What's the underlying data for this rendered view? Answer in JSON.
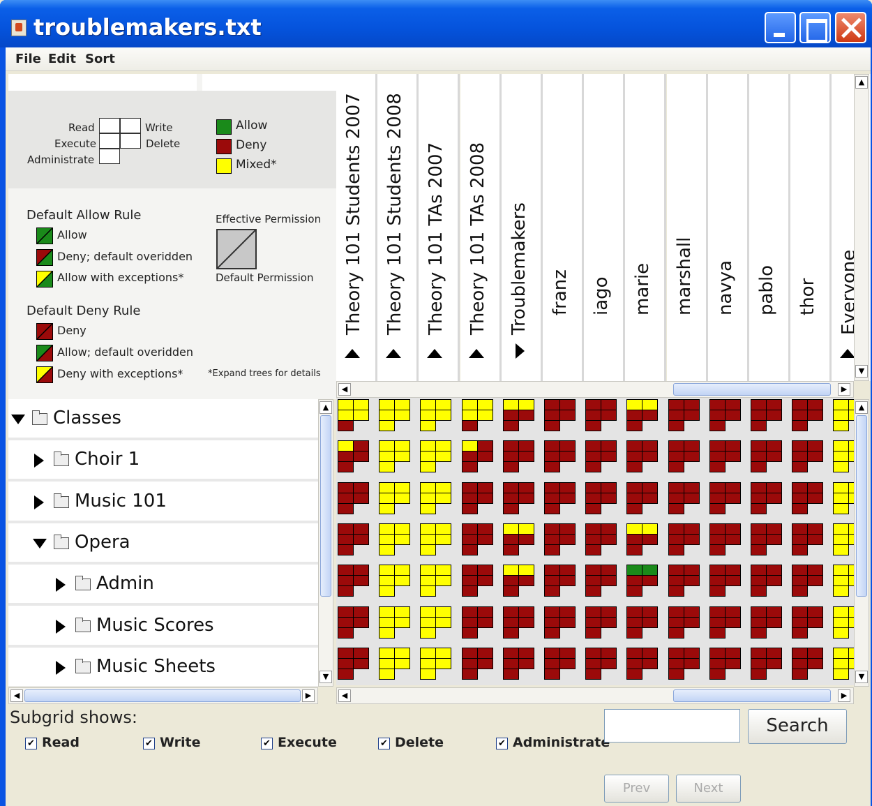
{
  "window": {
    "title": "troublemakers.txt"
  },
  "menu": [
    "File",
    "Edit",
    "Sort"
  ],
  "legend": {
    "layout_labels": {
      "read": "Read",
      "write": "Write",
      "execute": "Execute",
      "delete": "Delete",
      "administrate": "Administrate"
    },
    "colors": {
      "allow": "Allow",
      "deny": "Deny",
      "mixed": "Mixed*"
    },
    "palette": {
      "allow": "#1a8a1a",
      "deny": "#9b0a0a",
      "mixed": "#ffff00"
    },
    "default_allow_rule": {
      "title": "Default Allow Rule",
      "items": [
        "Allow",
        "Deny; default overidden",
        "Allow with exceptions*"
      ]
    },
    "default_deny_rule": {
      "title": "Default Deny Rule",
      "items": [
        "Deny",
        "Allow; default overidden",
        "Deny with exceptions*"
      ]
    },
    "effective_permission": "Effective Permission",
    "default_permission": "Default Permission",
    "footnote": "*Expand trees for details"
  },
  "columns": [
    {
      "label": "Theory 101 Students 2007",
      "arrow": "up"
    },
    {
      "label": "Theory 101 Students 2008",
      "arrow": "up"
    },
    {
      "label": "Theory 101 TAs 2007",
      "arrow": "up"
    },
    {
      "label": "Theory 101 TAs 2008",
      "arrow": "up"
    },
    {
      "label": "Troublemakers",
      "arrow": "right"
    },
    {
      "label": "franz",
      "arrow": ""
    },
    {
      "label": "iago",
      "arrow": ""
    },
    {
      "label": "marie",
      "arrow": ""
    },
    {
      "label": "marshall",
      "arrow": ""
    },
    {
      "label": "navya",
      "arrow": ""
    },
    {
      "label": "pablo",
      "arrow": ""
    },
    {
      "label": "thor",
      "arrow": ""
    },
    {
      "label": "Everyone",
      "arrow": "up"
    }
  ],
  "tree": [
    {
      "label": "Classes",
      "depth": 0,
      "expanded": true
    },
    {
      "label": "Choir 1",
      "depth": 1,
      "expanded": false
    },
    {
      "label": "Music 101",
      "depth": 1,
      "expanded": false
    },
    {
      "label": "Opera",
      "depth": 1,
      "expanded": true
    },
    {
      "label": "Admin",
      "depth": 2,
      "expanded": false
    },
    {
      "label": "Music Scores",
      "depth": 2,
      "expanded": false
    },
    {
      "label": "Music Sheets",
      "depth": 2,
      "expanded": false
    }
  ],
  "grid": [
    [
      "YYYYR",
      "YYYYY",
      "YYYYY",
      "YYYYR",
      "YYRRR",
      "RRRRR",
      "RRRRR",
      "YYRRR",
      "RRRRR",
      "RRRRR",
      "RRRRR",
      "RRRRR",
      "YYYYY"
    ],
    [
      "YRRRR",
      "YYYYY",
      "YYYYY",
      "YRRRR",
      "RRRRR",
      "RRRRR",
      "RRRRR",
      "RRRRR",
      "RRRRR",
      "RRRRR",
      "RRRRR",
      "RRRRR",
      "YYYYY"
    ],
    [
      "RRRRR",
      "YYYYY",
      "YYYYY",
      "RRRRR",
      "RRRRR",
      "RRRRR",
      "RRRRR",
      "RRRRR",
      "RRRRR",
      "RRRRR",
      "RRRRR",
      "RRRRR",
      "YYYYY"
    ],
    [
      "RRRRR",
      "YYYYY",
      "YYYYY",
      "RRRRR",
      "YYRRR",
      "RRRRR",
      "RRRRR",
      "YYRRR",
      "RRRRR",
      "RRRRR",
      "RRRRR",
      "RRRRR",
      "YYYYY"
    ],
    [
      "RRRRR",
      "YYYYY",
      "YYYYY",
      "RRRRR",
      "YYRRR",
      "RRRRR",
      "RRRRR",
      "GGRRR",
      "RRRRR",
      "RRRRR",
      "RRRRR",
      "RRRRR",
      "YYYYY"
    ],
    [
      "RRRRR",
      "YYYYY",
      "YYYYY",
      "RRRRR",
      "RRRRR",
      "RRRRR",
      "RRRRR",
      "RRRRR",
      "RRRRR",
      "RRRRR",
      "RRRRR",
      "RRRRR",
      "YYYYY"
    ],
    [
      "RRRRR",
      "YYYYY",
      "YYYYY",
      "RRRRR",
      "RRRRR",
      "RRRRR",
      "RRRRR",
      "RRRRR",
      "RRRRR",
      "RRRRR",
      "RRRRR",
      "RRRRR",
      "YYYYY"
    ]
  ],
  "subgrid": {
    "label": "Subgrid shows:",
    "options": [
      {
        "label": "Read",
        "checked": true
      },
      {
        "label": "Write",
        "checked": true
      },
      {
        "label": "Execute",
        "checked": true
      },
      {
        "label": "Delete",
        "checked": true
      },
      {
        "label": "Administrate",
        "checked": true
      }
    ]
  },
  "search": {
    "value": "",
    "button": "Search"
  },
  "pager": {
    "prev": "Prev",
    "next": "Next"
  }
}
